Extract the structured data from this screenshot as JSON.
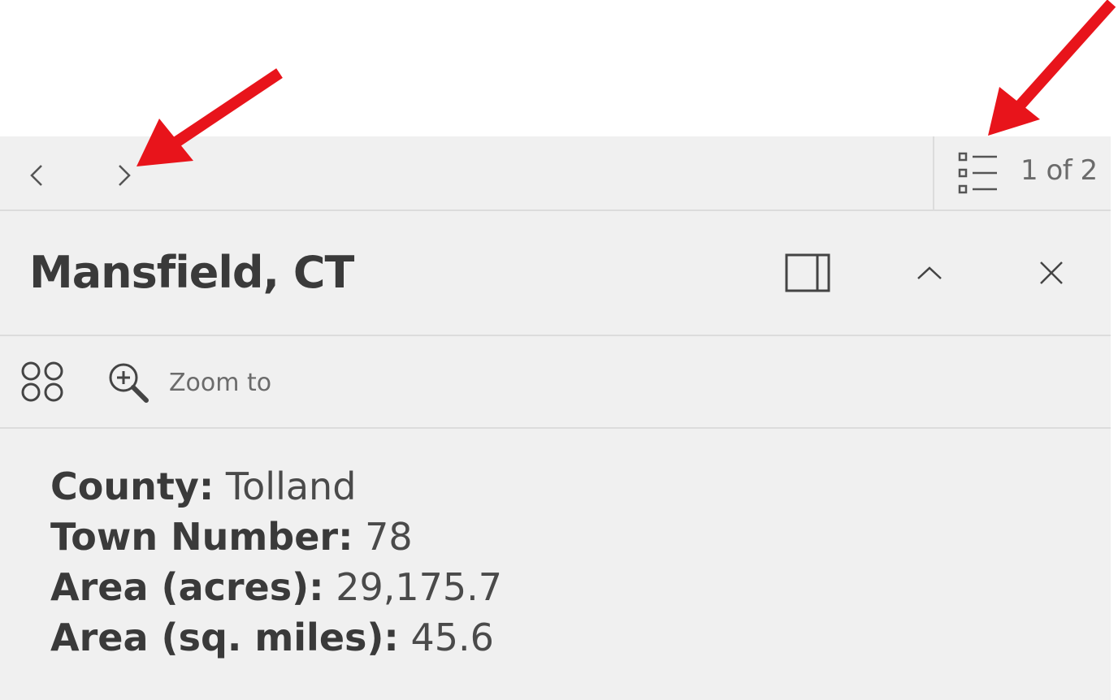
{
  "navigation": {
    "pager_text": "1 of 2"
  },
  "header": {
    "title": "Mansfield, CT"
  },
  "actions": {
    "zoom_label": "Zoom to"
  },
  "attributes": [
    {
      "label": "County:",
      "value": "Tolland"
    },
    {
      "label": "Town Number:",
      "value": "78"
    },
    {
      "label": "Area (acres):",
      "value": "29,175.7"
    },
    {
      "label": "Area (sq. miles):",
      "value": "45.6"
    }
  ],
  "annotation_color": "#e8141b"
}
